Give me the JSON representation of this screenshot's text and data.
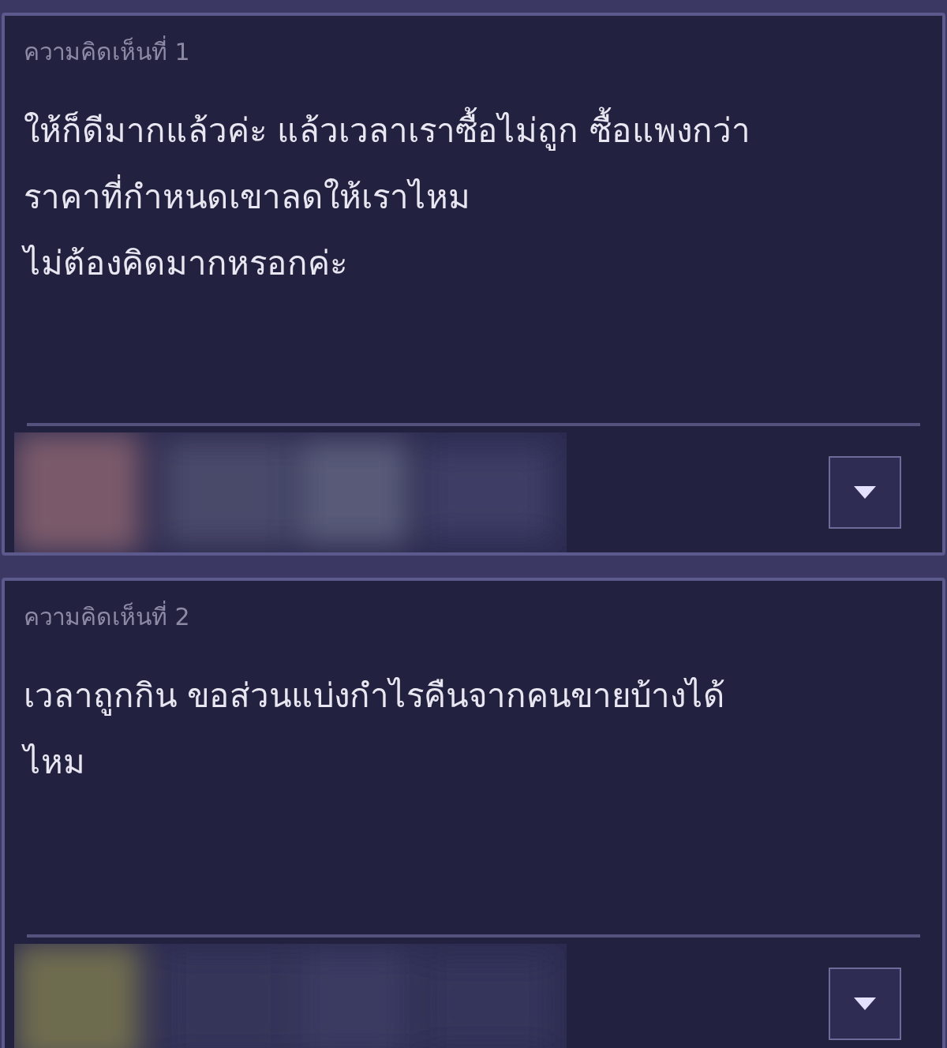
{
  "comments": [
    {
      "label": "ความคิดเห็นที่ 1",
      "lines": [
        "ให้ก็ดีมากแล้วค่ะ แล้วเวลาเราซื้อไม่ถูก ซื้อแพงกว่า",
        "ราคาที่กำหนดเขาลดให้เราไหม",
        "ไม่ต้องคิดมากหรอกค่ะ"
      ],
      "author": {
        "kind": "picture"
      }
    },
    {
      "label": "ความคิดเห็นที่ 2",
      "lines": [
        "เวลาถูกกิน ขอส่วนแบ่งกำไรคืนจากคนขายบ้างได้",
        "ไหม"
      ],
      "author": {
        "kind": "picture"
      }
    }
  ]
}
